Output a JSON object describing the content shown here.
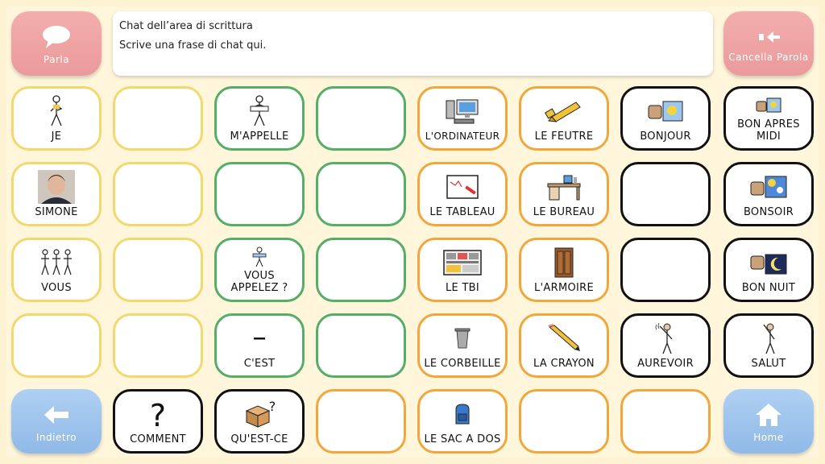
{
  "top_bar": {
    "speak_button": {
      "label": "Parla",
      "icon": "speech-bubble-icon"
    },
    "chat": {
      "title": "Chat dell’area di scrittura",
      "placeholder": "Scrive una frase di chat qui."
    },
    "delete_button": {
      "label": "Cancella Parola",
      "icon": "delete-arrow-icon"
    }
  },
  "grid": {
    "row1": [
      "JE",
      "",
      "M'APPELLE",
      "",
      "L'ORDINATEUR",
      "LE FEUTRE",
      "BONJOUR",
      "BON APRES MIDI"
    ],
    "row2": [
      "SIMONE",
      "",
      "",
      "",
      "LE TABLEAU",
      "LE BUREAU",
      "",
      "BONSOIR"
    ],
    "row3": [
      "VOUS",
      "",
      "VOUS APPELEZ ?",
      "",
      "LE TBI",
      "L'ARMOIRE",
      "",
      "BON NUIT"
    ],
    "row4": [
      "",
      "",
      "C'EST",
      "",
      "LE CORBEILLE",
      "LA CRAYON",
      "AUREVOIR",
      "SALUT"
    ],
    "row5": [
      "COMMENT",
      "QU'EST-CE",
      "",
      "LE SAC A DOS",
      "",
      ""
    ]
  },
  "bottom_bar": {
    "back_button": {
      "label": "Indietro",
      "icon": "left-arrow-icon"
    },
    "home_button": {
      "label": "Home",
      "icon": "home-icon"
    }
  },
  "colors": {
    "yellow_border": "#f3d870",
    "green_border": "#55ad66",
    "orange_border": "#f2a73d",
    "black_border": "#111111",
    "red_button": "#eb9a9a",
    "blue_button": "#8fb9e8"
  }
}
